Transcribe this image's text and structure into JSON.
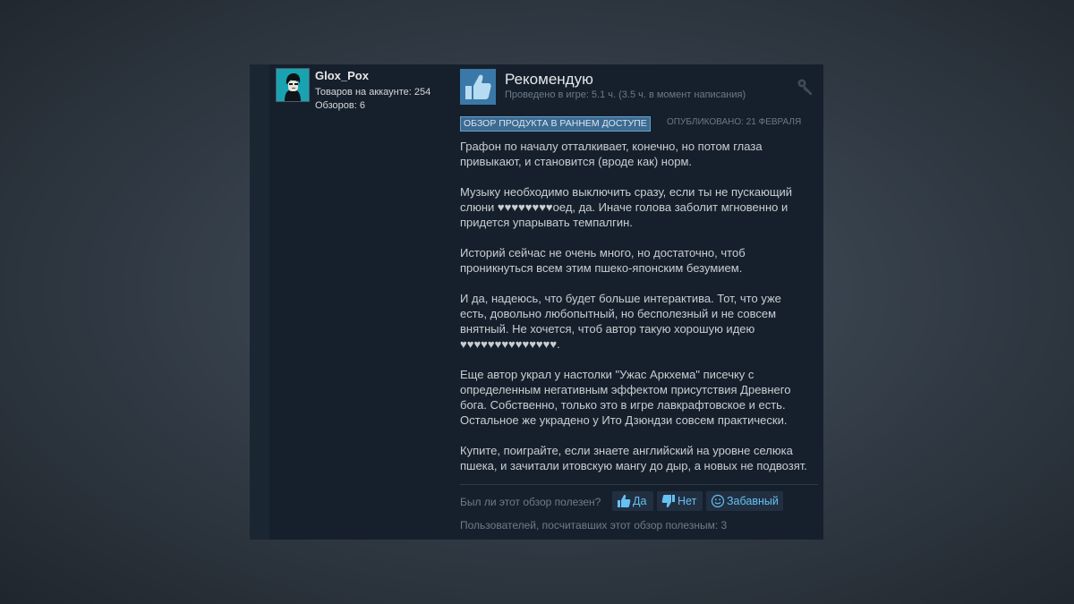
{
  "author": {
    "username": "Glox_Pox",
    "products_in_account": "Товаров на аккаунте: 254",
    "reviews": "Обзоров: 6"
  },
  "review": {
    "verdict": "Рекомендую",
    "playtime": "Проведено в игре: 5.1 ч. (3.5 ч. в момент написания)",
    "early_access_badge": "ОБЗОР ПРОДУКТА В РАННЕМ ДОСТУПЕ",
    "posted": "ОПУБЛИКОВАНО: 21 ФЕВРАЛЯ",
    "paragraphs": [
      "Графон по началу отталкивает, конечно, но потом глаза привыкают, и становится (вроде как) норм.",
      "Музыку необходимо выключить сразу, если ты не пускающий слюни ♥♥♥♥♥♥♥♥оед, да. Иначе голова заболит мгновенно и придется упарывать темпалгин.",
      "Историй сейчас не очень много, но достаточно, чтоб проникнуться всем этим пшеко-японским безумием.",
      "И да, надеюсь, что будет больше интерактива. Тот, что уже есть, довольно любопытный, но бесполезный и не совсем внятный. Не хочется, чтоб автор такую хорошую идею ♥♥♥♥♥♥♥♥♥♥♥♥♥♥.",
      "Еще автор украл у настолки \"Ужас Аркхема\" писечку с определенным негативным эффектом присутствия Древнего бога. Собственно, только это в игре лавкрафтовское и есть. Остальное же украдено у Ито Дзюндзи совсем практически.",
      "Купите, поиграйте, если знаете английский на уровне селюка пшека, и зачитали итовскую мангу до дыр, а новых не подвозят."
    ]
  },
  "footer": {
    "helpful_question": "Был ли этот обзор полезен?",
    "yes_label": "Да",
    "no_label": "Нет",
    "funny_label": "Забавный",
    "helpful_count": "Пользователей, посчитавших этот обзор полезным: 3"
  },
  "icons": {
    "thumbs_up": "thumbs-up-icon",
    "key": "key-icon",
    "thumbs_down": "thumbs-down-icon",
    "smiley": "smiley-icon"
  },
  "colors": {
    "card_bg": "#16202d",
    "accent_blue": "#66c0f4",
    "badge_bg": "#3d6b91",
    "thumb_box": "#3a78a8"
  }
}
